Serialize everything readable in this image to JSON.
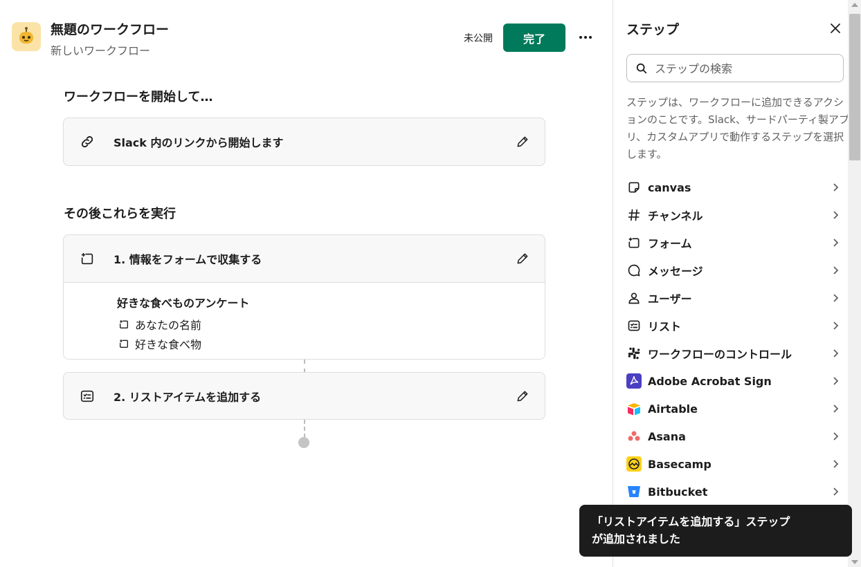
{
  "header": {
    "title": "無題のワークフロー",
    "subtitle": "新しいワークフロー",
    "status": "未公開",
    "done_label": "完了",
    "more_label": "•••"
  },
  "start_section": {
    "heading": "ワークフローを開始して…",
    "trigger_label": "Slack 内のリンクから開始します"
  },
  "then_section": {
    "heading": "その後これらを実行",
    "steps": [
      {
        "label": "1. 情報をフォームで収集する",
        "form_title": "好きな食べものアンケート",
        "fields": [
          "あなたの名前",
          "好きな食べ物"
        ]
      },
      {
        "label": "2. リストアイテムを追加する"
      }
    ]
  },
  "panel": {
    "title": "ステップ",
    "search_placeholder": "ステップの検索",
    "description": "ステップは、ワークフローに追加できるアクションのことです。Slack、サードパーティ製アプリ、カスタムアプリで動作するステップを選択します。",
    "items": [
      {
        "label": "canvas",
        "icon": "canvas-icon"
      },
      {
        "label": "チャンネル",
        "icon": "hash-icon"
      },
      {
        "label": "フォーム",
        "icon": "form-icon"
      },
      {
        "label": "メッセージ",
        "icon": "message-icon"
      },
      {
        "label": "ユーザー",
        "icon": "user-icon"
      },
      {
        "label": "リスト",
        "icon": "list-icon"
      },
      {
        "label": "ワークフローのコントロール",
        "icon": "slack-icon"
      },
      {
        "label": "Adobe Acrobat Sign",
        "icon": "adobe-icon"
      },
      {
        "label": "Airtable",
        "icon": "airtable-icon"
      },
      {
        "label": "Asana",
        "icon": "asana-icon"
      },
      {
        "label": "Basecamp",
        "icon": "basecamp-icon"
      },
      {
        "label": "Bitbucket",
        "icon": "bitbucket-icon"
      }
    ]
  },
  "toast": {
    "line1": "「リストアイテムを追加する」ステップ",
    "line2": "が追加されました"
  },
  "colors": {
    "accent": "#007a5a",
    "toast_bg": "#1d1c1d",
    "card_bg": "#f8f8f8"
  }
}
